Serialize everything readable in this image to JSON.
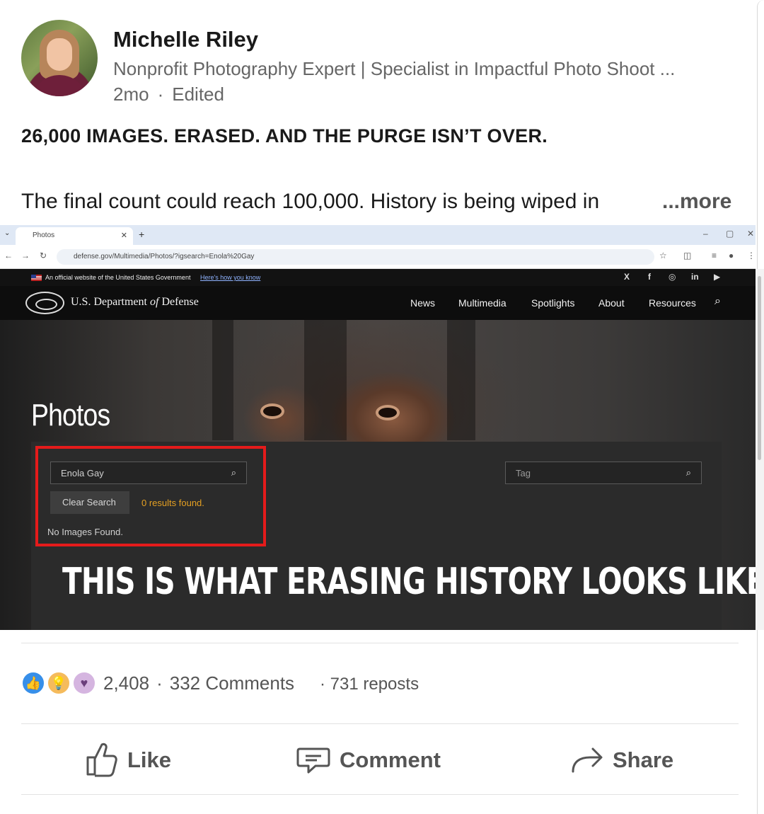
{
  "author": {
    "name": "Michelle Riley",
    "headline": "Nonprofit Photography Expert | Specialist in Impactful Photo Shoot ...",
    "time": "2mo",
    "edited": "Edited"
  },
  "post": {
    "headline": "26,000 IMAGES. ERASED. AND THE PURGE ISN’T OVER.",
    "body": "The final count could reach 100,000. History is being wiped in",
    "more_label": "...more"
  },
  "screenshot": {
    "browser": {
      "tab_title": "Photos",
      "url": "defense.gov/Multimedia/Photos/?igsearch=Enola%20Gay"
    },
    "gov_banner": {
      "text": "An official website of the United States Government",
      "link": "Here's how you know"
    },
    "site": {
      "title_prefix": "U.S. Department ",
      "title_of": "of",
      "title_suffix": " Defense",
      "nav": [
        "News",
        "Multimedia",
        "Spotlights",
        "About",
        "Resources"
      ],
      "social": [
        "X",
        "f",
        "◎",
        "in",
        "▶"
      ]
    },
    "page": {
      "title": "Photos",
      "search_value": "Enola Gay",
      "tag_placeholder": "Tag",
      "clear_label": "Clear Search",
      "results_text": "0 results found.",
      "no_images": "No Images Found."
    },
    "overlay_caption": "THIS IS WHAT ERASING HISTORY LOOKS LIKE."
  },
  "social_counts": {
    "reactions": "2,408",
    "comments": "332 Comments",
    "reposts": "· 731 reposts",
    "reaction_icons": [
      "like-icon",
      "insightful-icon",
      "support-icon"
    ]
  },
  "actions": {
    "like": "Like",
    "comment": "Comment",
    "share": "Share"
  },
  "colors": {
    "highlight_box": "#e41b1b",
    "results_text": "#e5a022",
    "like_blue": "#378fe9"
  }
}
